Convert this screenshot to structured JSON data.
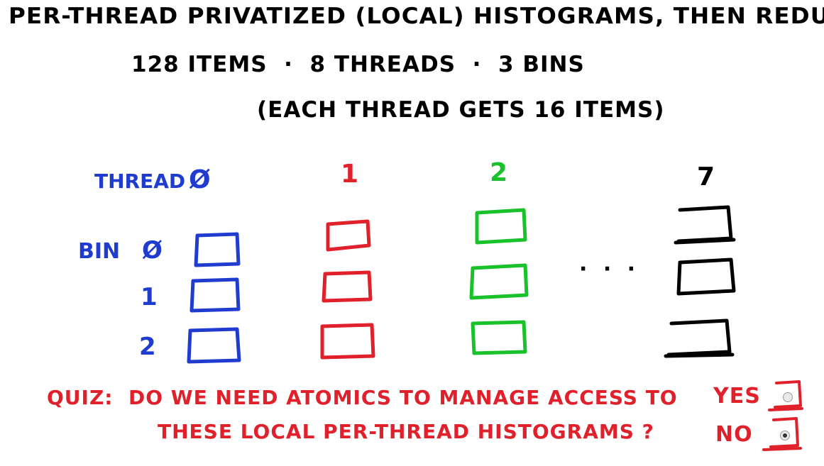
{
  "title": "PER-THREAD PRIVATIZED (LOCAL) HISTOGRAMS, THEN REDUCE",
  "subtitle": "128 ITEMS  ·  8 THREADS  ·  3 BINS",
  "subnote": "(EACH THREAD GETS 16 ITEMS)",
  "thread_label": "THREAD",
  "bin_label": "BIN",
  "threads": [
    {
      "label": "Ø",
      "color": "#1f3ccf"
    },
    {
      "label": "1",
      "color": "#e0202a"
    },
    {
      "label": "2",
      "color": "#19c12a"
    },
    {
      "label": "7",
      "color": "#000000"
    }
  ],
  "bins": [
    "Ø",
    "1",
    "2"
  ],
  "ellipsis": "· · ·",
  "quiz": {
    "line1": "QUIZ:  DO WE NEED ATOMICS TO MANAGE ACCESS TO",
    "line2": "THESE LOCAL PER-THREAD HISTOGRAMS ?",
    "options": [
      {
        "label": "YES",
        "selected": false
      },
      {
        "label": "NO",
        "selected": true
      }
    ]
  }
}
